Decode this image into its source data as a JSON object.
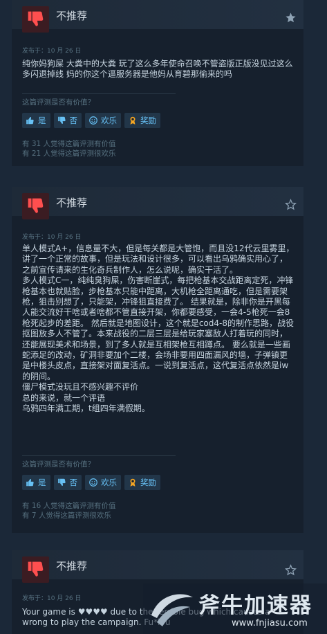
{
  "colors": {
    "accent": "#67c1f5",
    "background": "#1b2838",
    "thumb_bg": "#3b1c22",
    "thumb_icon": "#ff4f4f"
  },
  "ui": {
    "helpful_question": "这篇评测是否有价值？",
    "yes_label": "是",
    "no_label": "否",
    "funny_label": "欢乐",
    "award_label": "奖励"
  },
  "reviews": [
    {
      "verdict": "不推荐",
      "icon": "thumbs-down-icon",
      "posted": "发布于：10 月 26 日",
      "body": [
        "纯你妈狗屎 大粪中的大粪 玩了这么多年使命召唤不管盗版正版没见过这么多闪退掉线 妈的你这个逼服务器是他妈从育碧那偷来的吗"
      ],
      "helpful_count": "有 31 人觉得这篇评测有价值",
      "funny_count": "有 21 人觉得这篇评测很欢乐"
    },
    {
      "verdict": "不推荐",
      "icon": "thumbs-down-icon",
      "posted": "发布于：10 月 26 日",
      "body": [
        "单人模式A+，信息量不大，但是每关都是大管饱，而且没12代云里雾里，讲了一个正常的故事，但是玩法和设计很多，可以看出乌鸦确实用心了，之前宣传请来的生化奇兵制作人，怎么说呢，确实干活了。",
        "多人模式C一，纯纯臭狗屎，伤害断崖式，每把枪基本交战距离定死，冲锋枪基本也就贴脸，步枪基本只能中距离，大机枪全距离通吃，但是需要架枪，狙击别想了，只能架，冲锋狙直接费了。 结果就是，除非你是开黑每人能交流好干啥或者啥都不管直接开架，你都要感受，一会4-5枪死一会8枪死起步的差距。 然后就是地图设计，这个就是cod4-8的制作思路，战役抠图放多人不管了。本来战役的二层三层是给玩家塞敌人打着玩的同时，还能展现美术和场景，到了多人就是互相架枪互相蹲点。 要么就是一些画蛇添足的改动，矿洞非要加个二楼，会场非要用四面漏风的墙，子弹镇更是中楼头皮点，直接架对面复活点。一说到复活点，这代复活点依然是iw的阴间。",
        "僵尸模式没玩且不感兴趣不评价",
        "总的来说，就一个评语",
        "乌鸦四年满工期，t组四年满假期。"
      ],
      "helpful_count": "有 16 人觉得这篇评测有价值",
      "funny_count": "有 7 人觉得这篇评测很欢乐"
    },
    {
      "verdict": "不推荐",
      "icon": "thumbs-down-icon",
      "posted": "发布于：10 月 26 日",
      "body": [
        "Your game is ♥♥♥♥ due to the terrible bug which causes a wrong to play the campaign. Fu*k u"
      ]
    }
  ],
  "watermark": {
    "name": "斧牛加速器",
    "url": "www.fnjiasu.com"
  }
}
